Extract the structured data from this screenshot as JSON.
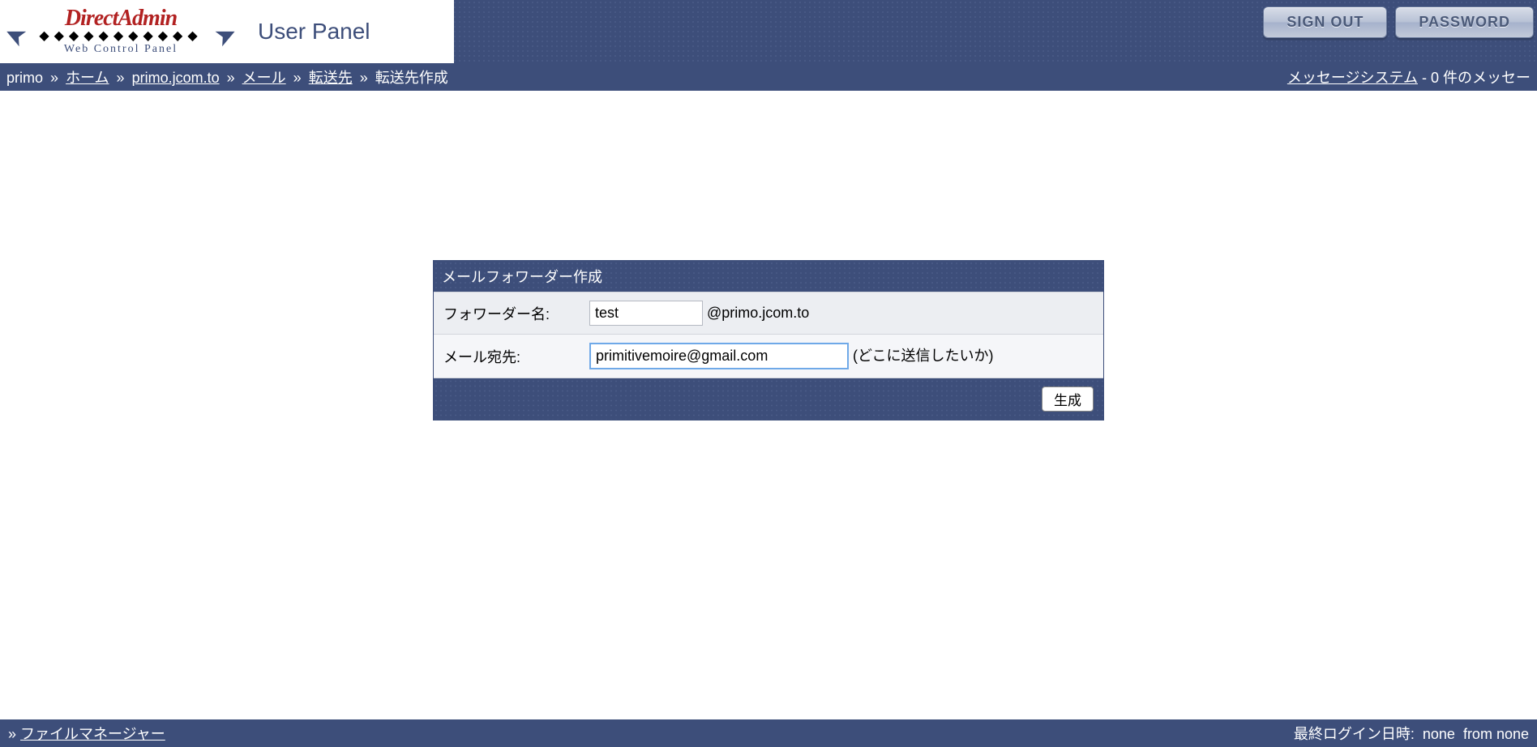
{
  "logo": {
    "main": "DirectAdmin",
    "sub": "Web Control Panel"
  },
  "panel_title": "User Panel",
  "header_buttons": {
    "signout": "SIGN OUT",
    "password": "PASSWORD"
  },
  "breadcrumb": {
    "user": "primo",
    "items": [
      {
        "label": "ホーム",
        "link": true
      },
      {
        "label": "primo.jcom.to",
        "link": true
      },
      {
        "label": "メール",
        "link": true
      },
      {
        "label": "転送先",
        "link": true
      },
      {
        "label": "転送先作成",
        "link": false
      }
    ],
    "sep": "»"
  },
  "messages": {
    "link": "メッセージシステム",
    "sep": " - ",
    "count": "0",
    "suffix": " 件のメッセー"
  },
  "form": {
    "title": "メールフォワーダー作成",
    "name_label": "フォワーダー名:",
    "name_value": "test",
    "domain_suffix": "@primo.jcom.to",
    "dest_label": "メール宛先:",
    "dest_value": "primitivemoire@gmail.com",
    "dest_hint": "(どこに送信したいか)",
    "submit": "生成"
  },
  "footer": {
    "left_sep": "»",
    "filemanager": "ファイルマネージャー",
    "last_login_label": "最終ログイン日時:",
    "last_login_value": "none",
    "from_label": "from",
    "from_value": "none"
  }
}
